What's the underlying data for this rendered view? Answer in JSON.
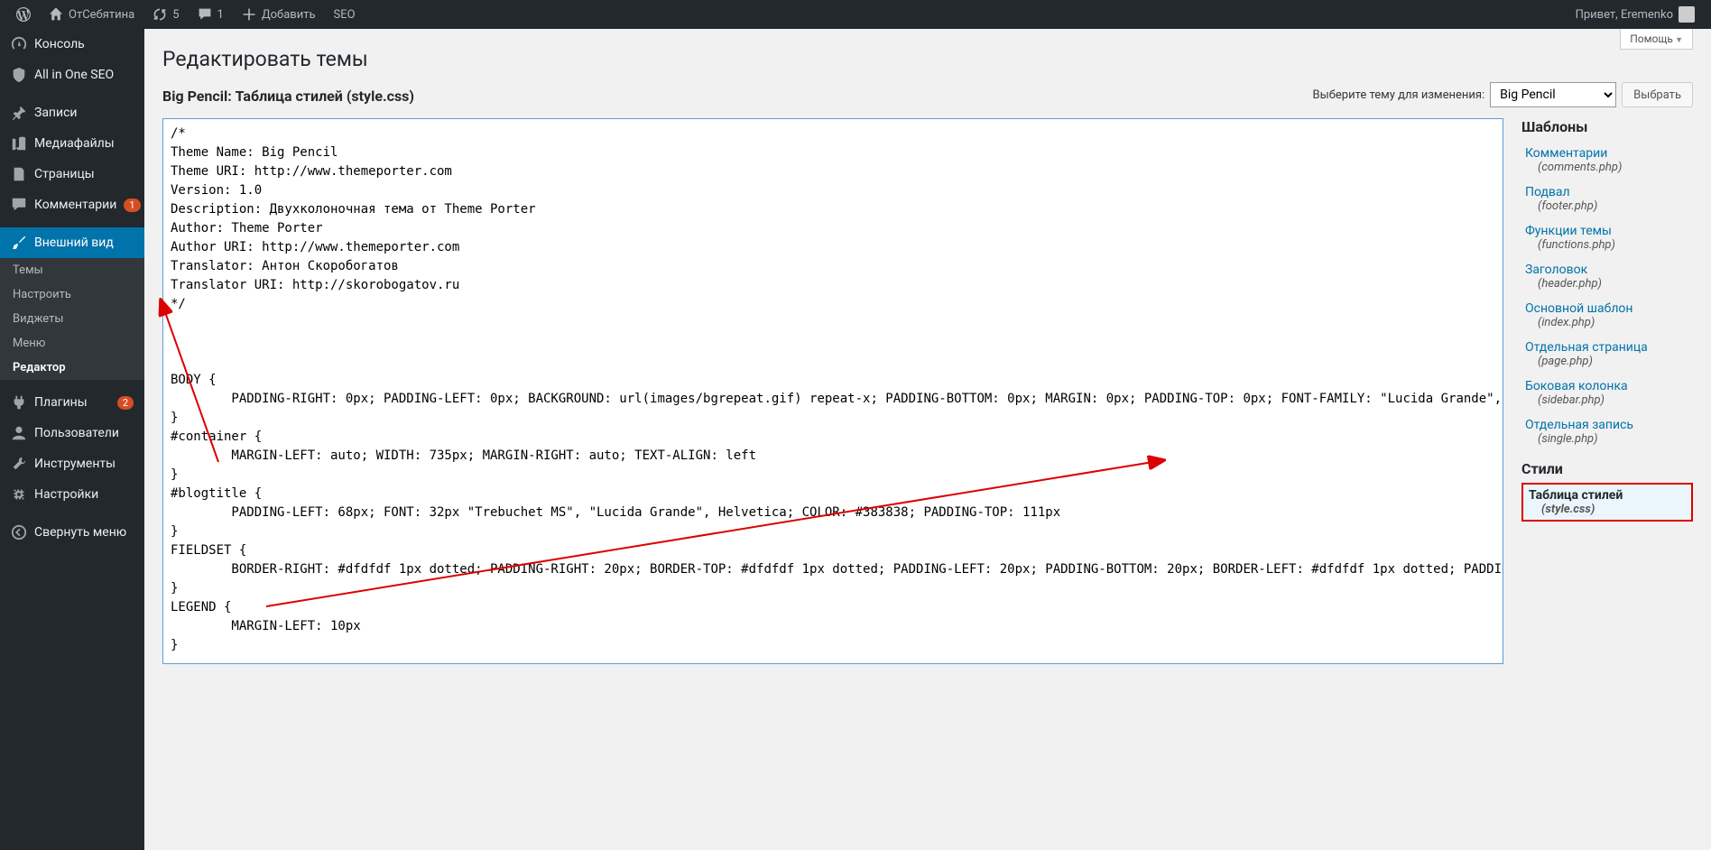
{
  "adminbar": {
    "site_name": "ОтСебятина",
    "refresh_count": "5",
    "comments_count": "1",
    "add_new": "Добавить",
    "seo": "SEO",
    "greeting": "Привет, Eremenko"
  },
  "sidebar": {
    "dashboard": "Консоль",
    "seo": "All in One SEO",
    "posts": "Записи",
    "media": "Медиафайлы",
    "pages": "Страницы",
    "comments": "Комментарии",
    "comments_badge": "1",
    "appearance": "Внешний вид",
    "submenu": {
      "themes": "Темы",
      "customize": "Настроить",
      "widgets": "Виджеты",
      "menus": "Меню",
      "editor": "Редактор"
    },
    "plugins": "Плагины",
    "plugins_badge": "2",
    "users": "Пользователи",
    "tools": "Инструменты",
    "settings": "Настройки",
    "collapse": "Свернуть меню"
  },
  "page": {
    "help": "Помощь",
    "title": "Редактировать темы",
    "file_title": "Big Pencil: Таблица стилей (style.css)",
    "picker_label": "Выберите тему для изменения:",
    "theme_selected": "Big Pencil",
    "select_button": "Выбрать"
  },
  "editor": {
    "content": "/*\nTheme Name: Big Pencil\nTheme URI: http://www.themeporter.com\nVersion: 1.0\nDescription: Двухколоночная тема от Theme Porter\nAuthor: Theme Porter\nAuthor URI: http://www.themeporter.com\nTranslator: Антон Скоробогатов\nTranslator URI: http://skorobogatov.ru\n*/\n\n\n\nBODY {\n        PADDING-RIGHT: 0px; PADDING-LEFT: 0px; BACKGROUND: url(images/bgrepeat.gif) repeat-x; PADDING-BOTTOM: 0px; MARGIN: 0px; PADDING-TOP: 0px; FONT-FAMILY: \"Lucida Grande\", LucidaGrande, Lucida, Verdana, Helvetica, Arial, sans-serif; TEXT-ALIGN: center\n}\n#container {\n        MARGIN-LEFT: auto; WIDTH: 735px; MARGIN-RIGHT: auto; TEXT-ALIGN: left\n}\n#blogtitle {\n        PADDING-LEFT: 68px; FONT: 32px \"Trebuchet MS\", \"Lucida Grande\", Helvetica; COLOR: #383838; PADDING-TOP: 111px\n}\nFIELDSET {\n        BORDER-RIGHT: #dfdfdf 1px dotted; PADDING-RIGHT: 20px; BORDER-TOP: #dfdfdf 1px dotted; PADDING-LEFT: 20px; PADDING-BOTTOM: 20px; BORDER-LEFT: #dfdfdf 1px dotted; PADDING-TOP: 20px; BORDER-BOTTOM: #dfdfdf 1px dotted\n}\nLEGEND {\n        MARGIN-LEFT: 10px\n}\n"
  },
  "files": {
    "templates_heading": "Шаблоны",
    "styles_heading": "Стили",
    "templates": [
      {
        "name": "Комментарии",
        "file": "(comments.php)"
      },
      {
        "name": "Подвал",
        "file": "(footer.php)"
      },
      {
        "name": "Функции темы",
        "file": "(functions.php)"
      },
      {
        "name": "Заголовок",
        "file": "(header.php)"
      },
      {
        "name": "Основной шаблон",
        "file": "(index.php)"
      },
      {
        "name": "Отдельная страница",
        "file": "(page.php)"
      },
      {
        "name": "Боковая колонка",
        "file": "(sidebar.php)"
      },
      {
        "name": "Отдельная запись",
        "file": "(single.php)"
      }
    ],
    "styles": [
      {
        "name": "Таблица стилей",
        "file": "(style.css)",
        "highlight": true
      }
    ]
  }
}
